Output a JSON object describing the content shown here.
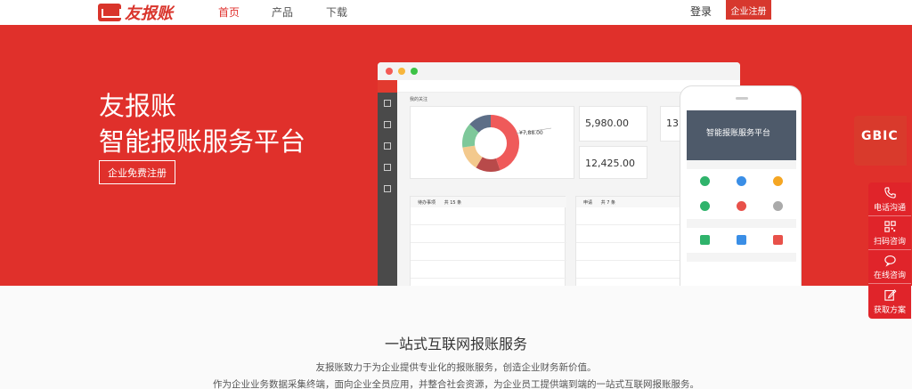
{
  "header": {
    "logo_text": "友报账",
    "nav": [
      "首页",
      "产品",
      "下载"
    ],
    "login": "登录",
    "register": "企业注册"
  },
  "hero": {
    "title_line1": "友报账",
    "title_line2": "智能报账服务平台",
    "cta": "企业免费注册",
    "desktop": {
      "section_label": "我的关注",
      "chart_label": "¥7,88.00",
      "card1_value": "5,980.00",
      "card2_value": "12,425.00",
      "card3_value": "13,9",
      "todo_label": "待办事项",
      "todo_count": "共 15 条",
      "apply_label": "申请",
      "apply_count": "共 7 条"
    },
    "phone": {
      "banner_title": "智能报账服务平台"
    }
  },
  "badge": {
    "title": "GBIC",
    "accent": "#d93a2c"
  },
  "contact": {
    "items": [
      {
        "label": "电话沟通",
        "icon": "phone-icon"
      },
      {
        "label": "扫码咨询",
        "icon": "qrcode-icon"
      },
      {
        "label": "在线咨询",
        "icon": "chat-icon"
      },
      {
        "label": "获取方案",
        "icon": "edit-icon"
      }
    ]
  },
  "section": {
    "title": "一站式互联网报账服务",
    "para1": "友报账致力于为企业提供专业化的报账服务，创造企业财务新价值。",
    "para2": "作为企业业务数据采集终端，面向企业全员应用，并整合社会资源，为企业员工提供端到端的一站式互联网报账服务。"
  },
  "colors": {
    "brand_red": "#e0302b"
  }
}
